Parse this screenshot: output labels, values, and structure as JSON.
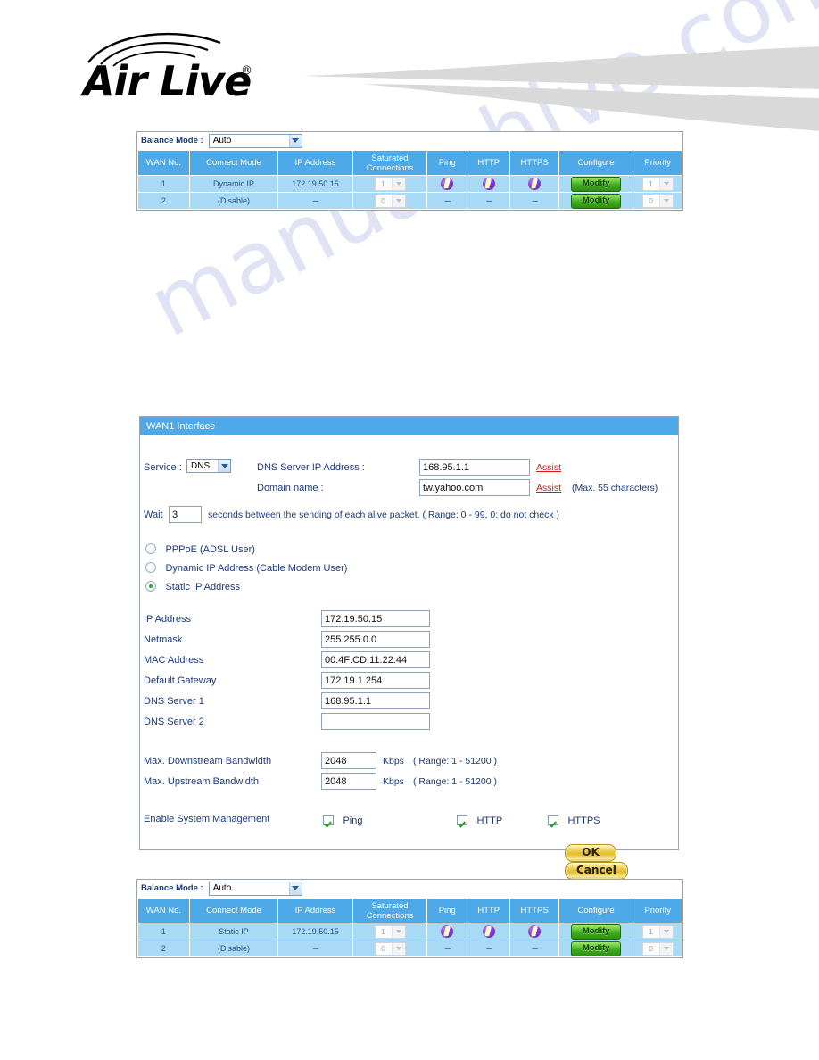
{
  "brand": {
    "name": "Air Live",
    "registered_mark": "®"
  },
  "watermark": {
    "text": "manualshive.com"
  },
  "top_table": {
    "balance_mode_label": "Balance Mode :",
    "balance_mode_value": "Auto",
    "headers": {
      "wan_no": "WAN No.",
      "connect_mode": "Connect Mode",
      "ip_address": "IP Address",
      "saturated_connections_line1": "Saturated",
      "saturated_connections_line2": "Connections",
      "ping": "Ping",
      "http": "HTTP",
      "https": "HTTPS",
      "configure": "Configure",
      "priority": "Priority"
    },
    "rows": [
      {
        "wan_no": "1",
        "connect_mode": "Dynamic IP",
        "ip_address": "172.19.50.15",
        "saturated": "1",
        "ping": "check",
        "http": "check",
        "https": "check",
        "configure": "Modify",
        "priority": "1"
      },
      {
        "wan_no": "2",
        "connect_mode": "(Disable)",
        "ip_address": "---",
        "saturated": "0",
        "ping": "---",
        "http": "---",
        "https": "---",
        "configure": "Modify",
        "priority": "0"
      }
    ]
  },
  "panel": {
    "title": "WAN1 Interface",
    "service_label": "Service :",
    "service_value": "DNS",
    "dns_server_ip_label": "DNS Server IP Address :",
    "dns_server_ip_value": "168.95.1.1",
    "domain_name_label": "Domain name :",
    "domain_name_value": "tw.yahoo.com",
    "assist_label": "Assist",
    "max_chars_note": "(Max. 55 characters)",
    "wait_prefix": "Wait",
    "wait_value": "3",
    "wait_suffix": "seconds between the sending of each alive packet. ( Range: 0 - 99, 0: do not check )",
    "connection_types": [
      {
        "label": "PPPoE (ADSL User)",
        "selected": false
      },
      {
        "label": "Dynamic IP Address (Cable Modem User)",
        "selected": false
      },
      {
        "label": "Static IP Address",
        "selected": true
      }
    ],
    "fields": [
      {
        "label": "IP Address",
        "value": "172.19.50.15"
      },
      {
        "label": "Netmask",
        "value": "255.255.0.0"
      },
      {
        "label": "MAC Address",
        "value": "00:4F:CD:11:22:44"
      },
      {
        "label": "Default Gateway",
        "value": "172.19.1.254"
      },
      {
        "label": "DNS Server 1",
        "value": "168.95.1.1"
      },
      {
        "label": "DNS Server 2",
        "value": ""
      }
    ],
    "bandwidth": [
      {
        "label": "Max. Downstream Bandwidth",
        "value": "2048",
        "unit": "Kbps",
        "range": "( Range: 1 - 51200 )"
      },
      {
        "label": "Max. Upstream Bandwidth",
        "value": "2048",
        "unit": "Kbps",
        "range": "( Range: 1 - 51200 )"
      }
    ],
    "system_management_label": "Enable System Management",
    "system_management": [
      {
        "label": "Ping",
        "checked": true
      },
      {
        "label": "HTTP",
        "checked": true
      },
      {
        "label": "HTTPS",
        "checked": true
      }
    ],
    "ok_label": "OK",
    "cancel_label": "Cancel"
  },
  "bottom_table": {
    "balance_mode_label": "Balance Mode :",
    "balance_mode_value": "Auto",
    "headers": {
      "wan_no": "WAN No.",
      "connect_mode": "Connect Mode",
      "ip_address": "IP Address",
      "saturated_connections_line1": "Saturated",
      "saturated_connections_line2": "Connections",
      "ping": "Ping",
      "http": "HTTP",
      "https": "HTTPS",
      "configure": "Configure",
      "priority": "Priority"
    },
    "rows": [
      {
        "wan_no": "1",
        "connect_mode": "Static IP",
        "ip_address": "172.19.50.15",
        "saturated": "1",
        "ping": "check",
        "http": "check",
        "https": "check",
        "configure": "Modify",
        "priority": "1"
      },
      {
        "wan_no": "2",
        "connect_mode": "(Disable)",
        "ip_address": "---",
        "saturated": "0",
        "ping": "---",
        "http": "---",
        "https": "---",
        "configure": "Modify",
        "priority": "0"
      }
    ]
  },
  "colors": {
    "table_header_blue": "#4da9e8",
    "table_row_blue": "#a8daf6",
    "label_navy": "#1b3a7a",
    "assist_red": "#d01a1a",
    "modify_green": "#3fae1f",
    "watermark_lavender": "#ccd3ee"
  }
}
